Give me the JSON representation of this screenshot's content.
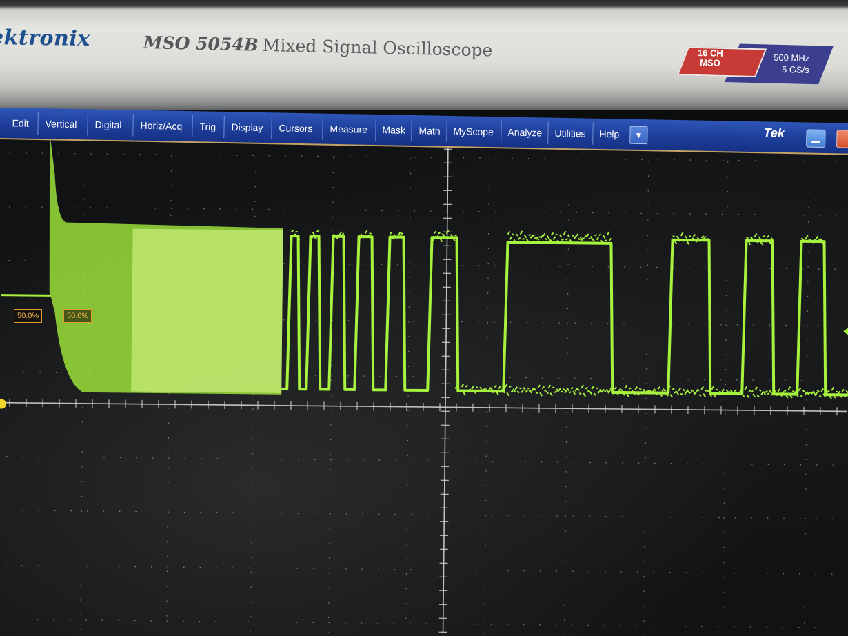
{
  "instrument": {
    "brand": "ektronix",
    "model_number": "MSO 5054B",
    "model_description": "Mixed Signal Oscilloscope",
    "badge_channels": "16 CH",
    "badge_type": "MSO",
    "badge_bandwidth": "500 MHz",
    "badge_sample_rate": "5 GS/s"
  },
  "menubar": {
    "items": [
      "Edit",
      "Vertical",
      "Digital",
      "Horiz/Acq",
      "Trig",
      "Display",
      "Cursors",
      "Measure",
      "Mask",
      "Math",
      "MyScope",
      "Analyze",
      "Utilities",
      "Help"
    ],
    "logo": "Tek",
    "dropdown_icon": "chevron-down-icon"
  },
  "markers": {
    "trigger_level_left": "50.0%",
    "trigger_level_right": "50.0%"
  },
  "colors": {
    "trace": "#a6f23c",
    "menubar": "#1d3d99",
    "marker": "#e39a2e",
    "graticule": "#d0d2d4"
  }
}
